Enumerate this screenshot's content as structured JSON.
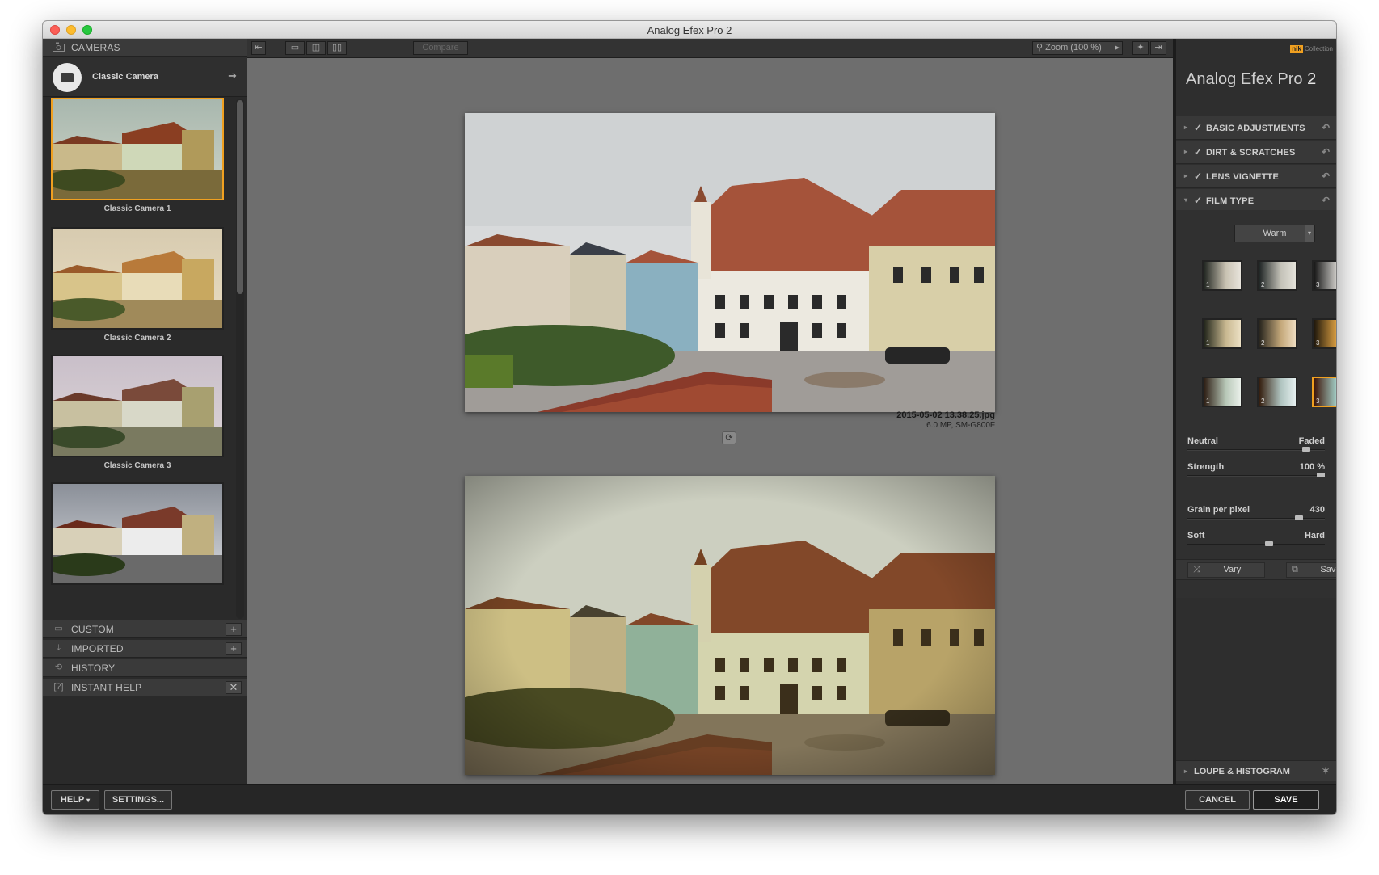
{
  "window": {
    "title": "Analog Efex Pro 2"
  },
  "left": {
    "cameras_label": "CAMERAS",
    "camera_name": "Classic Camera",
    "presets": [
      {
        "label": "Classic Camera 1",
        "selected": true
      },
      {
        "label": "Classic Camera 2",
        "selected": false
      },
      {
        "label": "Classic Camera 3",
        "selected": false
      },
      {
        "label": "",
        "selected": false
      }
    ],
    "sections": [
      {
        "label": "CUSTOM",
        "icon": "custom-icon",
        "action": "+"
      },
      {
        "label": "IMPORTED",
        "icon": "import-icon",
        "action": "+"
      },
      {
        "label": "HISTORY",
        "icon": "history-icon",
        "action": ""
      },
      {
        "label": "INSTANT HELP",
        "icon": "help-icon",
        "action": "✕"
      }
    ]
  },
  "toolbar": {
    "compare_label": "Compare",
    "zoom_label": "Zoom (100 %)"
  },
  "preview": {
    "filename": "2015-05-02 13.38.25.jpg",
    "info": "6.0 MP, SM-G800F"
  },
  "right": {
    "brand_text": "Collection",
    "brand_nik": "nik",
    "app_title": "Analog Efex Pro",
    "app_version": "2",
    "controls": [
      {
        "label": "BASIC ADJUSTMENTS",
        "expanded": false
      },
      {
        "label": "DIRT & SCRATCHES",
        "expanded": false
      },
      {
        "label": "LENS VIGNETTE",
        "expanded": false
      },
      {
        "label": "FILM TYPE",
        "expanded": true
      }
    ],
    "film_dropdown": "Warm",
    "swatch_numbers": [
      "1",
      "2",
      "3"
    ],
    "sliders": {
      "neutral_label": "Neutral",
      "faded_label": "Faded",
      "strength_label": "Strength",
      "strength_value": "100 %",
      "grain_label": "Grain per pixel",
      "grain_value": "430",
      "soft_label": "Soft",
      "hard_label": "Hard",
      "neutral_faded": 0.89,
      "strength": 1.0,
      "grain": 0.83,
      "soft_hard": 0.6
    },
    "vary_label": "Vary",
    "save_label": "Save",
    "loupe_label": "LOUPE & HISTOGRAM"
  },
  "bottom": {
    "help_label": "HELP",
    "settings_label": "SETTINGS...",
    "cancel_label": "CANCEL",
    "save_label": "SAVE"
  },
  "colors": {
    "accent": "#f0a020"
  }
}
